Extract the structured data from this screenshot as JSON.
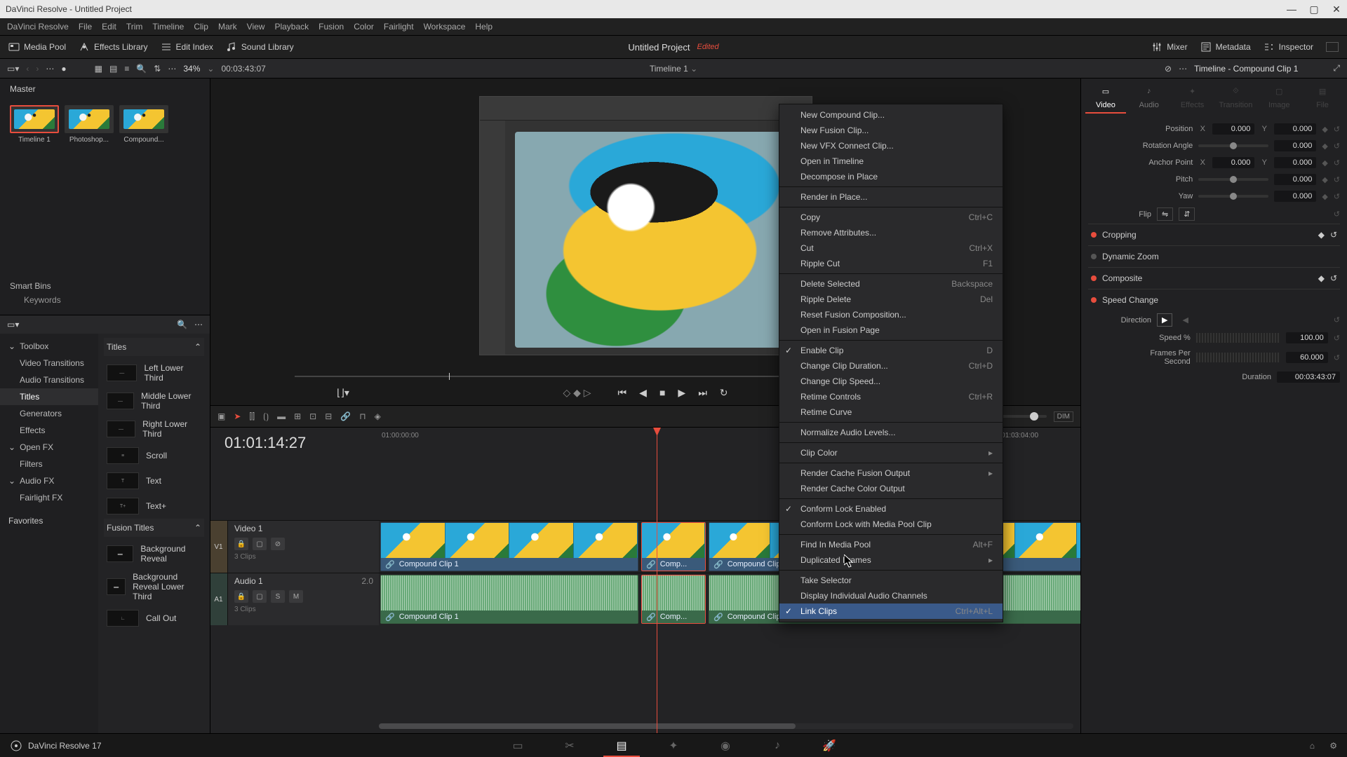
{
  "window": {
    "title": "DaVinci Resolve - Untitled Project"
  },
  "menus": [
    "DaVinci Resolve",
    "File",
    "Edit",
    "Trim",
    "Timeline",
    "Clip",
    "Mark",
    "View",
    "Playback",
    "Fusion",
    "Color",
    "Fairlight",
    "Workspace",
    "Help"
  ],
  "toolbar": {
    "media_pool": "Media Pool",
    "fx_library": "Effects Library",
    "edit_index": "Edit Index",
    "sound_library": "Sound Library",
    "mixer": "Mixer",
    "metadata": "Metadata",
    "inspector": "Inspector"
  },
  "project": {
    "name": "Untitled Project",
    "edited": "Edited"
  },
  "secbar": {
    "zoom": "34%",
    "tc": "00:03:43:07",
    "timeline": "Timeline 1",
    "insp_title": "Timeline - Compound Clip 1"
  },
  "pool": {
    "master": "Master",
    "clips": [
      {
        "name": "Timeline 1",
        "selected": true
      },
      {
        "name": "Photoshop...",
        "selected": false
      },
      {
        "name": "Compound...",
        "selected": false
      }
    ],
    "smartbins": "Smart Bins",
    "keywords": "Keywords"
  },
  "fx": {
    "cats": [
      {
        "label": "Toolbox",
        "sub": false,
        "exp": true
      },
      {
        "label": "Video Transitions",
        "sub": true
      },
      {
        "label": "Audio Transitions",
        "sub": true
      },
      {
        "label": "Titles",
        "sub": true,
        "selected": true
      },
      {
        "label": "Generators",
        "sub": true
      },
      {
        "label": "Effects",
        "sub": true
      },
      {
        "label": "Open FX",
        "sub": false,
        "exp": true
      },
      {
        "label": "Filters",
        "sub": true
      },
      {
        "label": "Audio FX",
        "sub": false,
        "exp": true
      },
      {
        "label": "Fairlight FX",
        "sub": true
      }
    ],
    "favorites": "Favorites",
    "group_titles": "Titles",
    "group_fusion": "Fusion Titles",
    "titles": [
      "Left Lower Third",
      "Middle Lower Third",
      "Right Lower Third",
      "Scroll",
      "Text",
      "Text+"
    ],
    "fusion_titles": [
      "Background Reveal",
      "Background Reveal Lower Third",
      "Call Out"
    ]
  },
  "timeline": {
    "tc": "01:01:14:27",
    "ticks": [
      "01:00:00:00",
      "01:03:04:00"
    ],
    "video_track": {
      "label": "V1",
      "name": "Video 1",
      "info": "3 Clips"
    },
    "audio_track": {
      "label": "A1",
      "name": "Audio 1",
      "ch": "2.0",
      "info": "3 Clips",
      "solo": "S",
      "mute": "M"
    },
    "clips": [
      {
        "name": "Compound Clip 1"
      },
      {
        "name": "Comp..."
      },
      {
        "name": "Compound Clip 1"
      }
    ]
  },
  "inspector": {
    "tabs": [
      "Video",
      "Audio",
      "Effects",
      "Transition",
      "Image",
      "File"
    ],
    "position": "Position",
    "pos_x": "0.000",
    "pos_y": "0.000",
    "rotation": "Rotation Angle",
    "rot_val": "0.000",
    "anchor": "Anchor Point",
    "anc_x": "0.000",
    "anc_y": "0.000",
    "pitch": "Pitch",
    "pitch_val": "0.000",
    "yaw": "Yaw",
    "yaw_val": "0.000",
    "flip": "Flip",
    "cropping": "Cropping",
    "dynzoom": "Dynamic Zoom",
    "composite": "Composite",
    "speed": "Speed Change",
    "direction": "Direction",
    "speed_pct": "Speed %",
    "speed_val": "100.00",
    "fps": "Frames Per Second",
    "fps_val": "60.000",
    "duration": "Duration",
    "dur_val": "00:03:43:07",
    "x": "X",
    "y": "Y"
  },
  "ctx": [
    {
      "t": "item",
      "label": "New Compound Clip..."
    },
    {
      "t": "item",
      "label": "New Fusion Clip..."
    },
    {
      "t": "item",
      "label": "New VFX Connect Clip..."
    },
    {
      "t": "item",
      "label": "Open in Timeline"
    },
    {
      "t": "item",
      "label": "Decompose in Place"
    },
    {
      "t": "sep"
    },
    {
      "t": "item",
      "label": "Render in Place..."
    },
    {
      "t": "sep"
    },
    {
      "t": "item",
      "label": "Copy",
      "sc": "Ctrl+C"
    },
    {
      "t": "item",
      "label": "Remove Attributes..."
    },
    {
      "t": "item",
      "label": "Cut",
      "sc": "Ctrl+X"
    },
    {
      "t": "item",
      "label": "Ripple Cut",
      "sc": "F1"
    },
    {
      "t": "sep"
    },
    {
      "t": "item",
      "label": "Delete Selected",
      "sc": "Backspace"
    },
    {
      "t": "item",
      "label": "Ripple Delete",
      "sc": "Del"
    },
    {
      "t": "item",
      "label": "Reset Fusion Composition..."
    },
    {
      "t": "item",
      "label": "Open in Fusion Page"
    },
    {
      "t": "sep"
    },
    {
      "t": "item",
      "label": "Enable Clip",
      "sc": "D",
      "chk": true
    },
    {
      "t": "item",
      "label": "Change Clip Duration...",
      "sc": "Ctrl+D"
    },
    {
      "t": "item",
      "label": "Change Clip Speed..."
    },
    {
      "t": "item",
      "label": "Retime Controls",
      "sc": "Ctrl+R"
    },
    {
      "t": "item",
      "label": "Retime Curve"
    },
    {
      "t": "sep"
    },
    {
      "t": "item",
      "label": "Normalize Audio Levels..."
    },
    {
      "t": "sep"
    },
    {
      "t": "item",
      "label": "Clip Color",
      "arr": true
    },
    {
      "t": "sep"
    },
    {
      "t": "item",
      "label": "Render Cache Fusion Output",
      "arr": true
    },
    {
      "t": "item",
      "label": "Render Cache Color Output"
    },
    {
      "t": "sep"
    },
    {
      "t": "item",
      "label": "Conform Lock Enabled",
      "chk": true
    },
    {
      "t": "item",
      "label": "Conform Lock with Media Pool Clip"
    },
    {
      "t": "sep"
    },
    {
      "t": "item",
      "label": "Find In Media Pool",
      "sc": "Alt+F"
    },
    {
      "t": "item",
      "label": "Duplicated Frames",
      "arr": true
    },
    {
      "t": "sep"
    },
    {
      "t": "item",
      "label": "Take Selector"
    },
    {
      "t": "item",
      "label": "Display Individual Audio Channels"
    },
    {
      "t": "item",
      "label": "Link Clips",
      "sc": "Ctrl+Alt+L",
      "chk": true,
      "hover": true
    }
  ],
  "bottom": {
    "status": "DaVinci Resolve 17"
  }
}
